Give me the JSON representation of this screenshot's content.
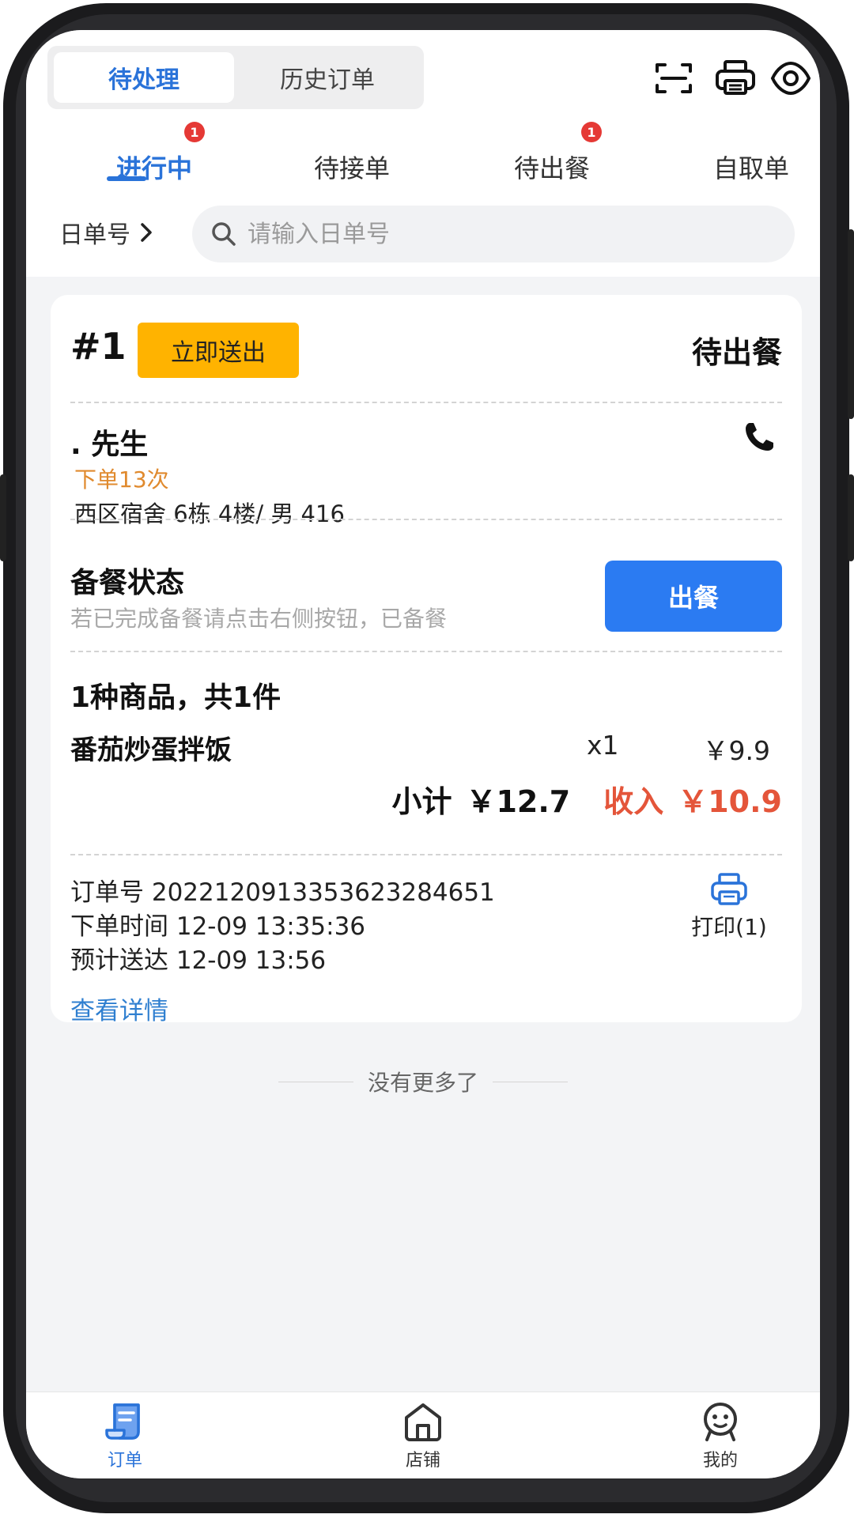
{
  "header": {
    "segments": [
      {
        "label": "待处理",
        "active": true
      },
      {
        "label": "历史订单",
        "active": false
      }
    ],
    "icons": [
      "scan-icon",
      "printer-icon",
      "eye-icon"
    ]
  },
  "tabs": [
    {
      "label": "进行中",
      "badge": "1",
      "active": true
    },
    {
      "label": "待接单",
      "badge": null,
      "active": false
    },
    {
      "label": "待出餐",
      "badge": "1",
      "active": false
    },
    {
      "label": "自取单",
      "badge": null,
      "active": false
    }
  ],
  "search": {
    "label": "日单号",
    "placeholder": "请输入日单号",
    "value": ""
  },
  "order": {
    "number": "#1",
    "action_label": "立即送出",
    "status": "待出餐",
    "customer_name": ". 先生",
    "order_count": "下单13次",
    "address": "西区宿舍 6栋 4楼/ 男 416",
    "prep_title": "备餐状态",
    "prep_hint": "若已完成备餐请点击右侧按钮，已备餐",
    "serve_label": "出餐",
    "goods_summary": "1种商品，共1件",
    "items": [
      {
        "name": "番茄炒蛋拌饭",
        "qty": "x1",
        "price": "￥9.9"
      }
    ],
    "subtotal_label": "小计",
    "subtotal": "￥12.7",
    "income_label": "收入",
    "income": "￥10.9",
    "order_id_line": "订单号 20221209133536232846​51",
    "order_time_line": "下单时间 12-09 13:35:36",
    "eta_line": "预计送达 12-09 13:56",
    "print_label": "打印(1)",
    "detail_link": "查看详情"
  },
  "footer_text": "没有更多了",
  "bottom_nav": [
    {
      "label": "订单",
      "icon": "orders-icon",
      "active": true
    },
    {
      "label": "店铺",
      "icon": "shop-icon",
      "active": false
    },
    {
      "label": "我的",
      "icon": "profile-icon",
      "active": false
    }
  ],
  "colors": {
    "accent": "#2a73d9",
    "serve_button": "#2b7bf2",
    "send_button": "#ffb300",
    "income": "#e4553a",
    "order_count": "#e08a2e",
    "badge": "#e53935"
  }
}
